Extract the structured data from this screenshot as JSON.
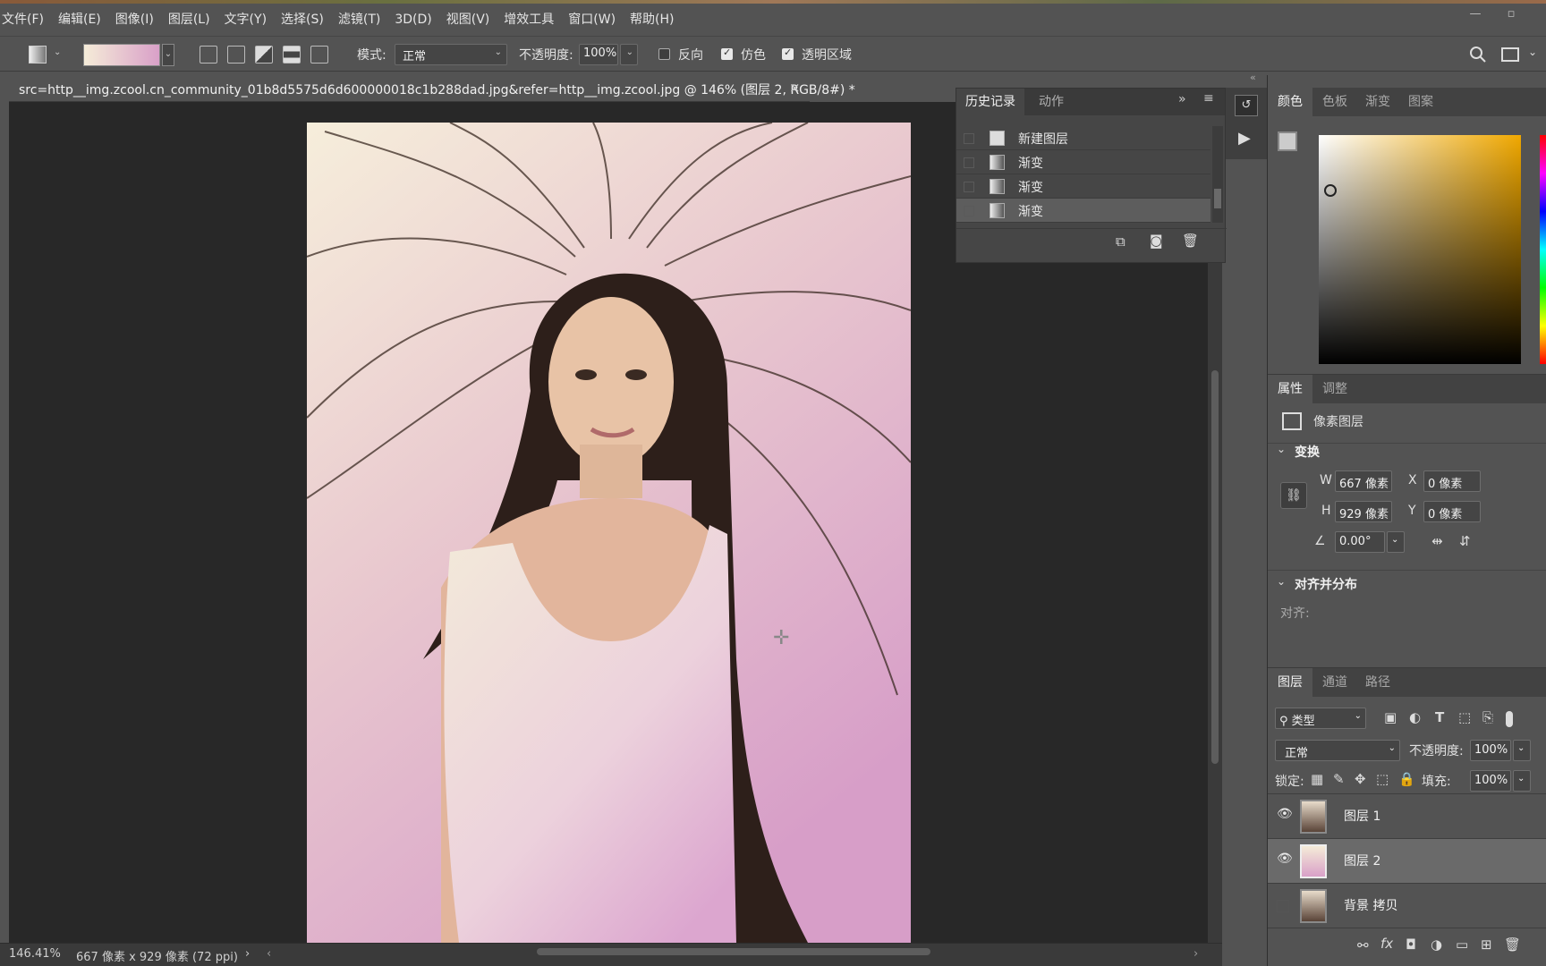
{
  "menu": [
    "文件(F)",
    "编辑(E)",
    "图像(I)",
    "图层(L)",
    "文字(Y)",
    "选择(S)",
    "滤镜(T)",
    "3D(D)",
    "视图(V)",
    "增效工具",
    "窗口(W)",
    "帮助(H)"
  ],
  "options": {
    "mode_label": "模式:",
    "mode_value": "正常",
    "opacity_label": "不透明度:",
    "opacity_value": "100%",
    "reverse_label": "反向",
    "dither_label": "仿色",
    "transparency_label": "透明区域",
    "reverse_checked": false,
    "dither_checked": true,
    "transparency_checked": true
  },
  "document": {
    "tab_title": "src=http__img.zcool.cn_community_01b8d5575d6d600000018c1b288dad.jpg&refer=http__img.zcool.jpg @ 146% (图层 2, RGB/8#) *",
    "close": "×"
  },
  "status": {
    "zoom": "146.41%",
    "doc_info": "667 像素 x 929 像素 (72 ppi)",
    "more": "›"
  },
  "history": {
    "tabs": [
      "历史记录",
      "动作"
    ],
    "items": [
      {
        "label": "新建图层",
        "selected": false
      },
      {
        "label": "渐变",
        "selected": false
      },
      {
        "label": "渐变",
        "selected": false
      },
      {
        "label": "渐变",
        "selected": true
      }
    ]
  },
  "color_panel": {
    "tabs": [
      "颜色",
      "色板",
      "渐变",
      "图案"
    ]
  },
  "properties": {
    "tabs": [
      "属性",
      "调整"
    ],
    "kind": "像素图层",
    "transform_header": "变换",
    "w_label": "W",
    "w_value": "667 像素",
    "x_label": "X",
    "x_value": "0 像素",
    "h_label": "H",
    "h_value": "929 像素",
    "y_label": "Y",
    "y_value": "0 像素",
    "angle_value": "0.00°",
    "align_header": "对齐并分布",
    "align_label": "对齐:"
  },
  "layers": {
    "tabs": [
      "图层",
      "通道",
      "路径"
    ],
    "filter_kind": "类型",
    "blend_mode": "正常",
    "opacity_label": "不透明度:",
    "opacity_value": "100%",
    "lock_label": "锁定:",
    "fill_label": "填充:",
    "fill_value": "100%",
    "items": [
      {
        "name": "图层 1",
        "visible": true,
        "selected": false
      },
      {
        "name": "图层 2",
        "visible": true,
        "selected": true
      },
      {
        "name": "背景 拷贝",
        "visible": false,
        "selected": false
      }
    ]
  },
  "colors": {
    "ui_bg": "#535353",
    "canvas_bg": "#282828",
    "gradient_start": "#f5ecd8",
    "gradient_end": "#d9a0c8"
  }
}
